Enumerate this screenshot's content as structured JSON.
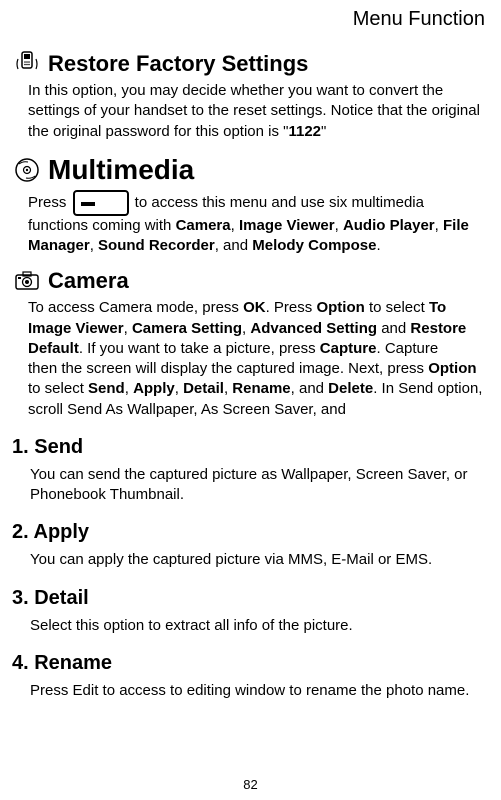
{
  "header": "Menu Function",
  "restore": {
    "title": "Restore Factory Settings",
    "body_pre": "In this option, you may decide whether you want to convert the settings of your handset to the reset settings. Notice that the original the original password for this option is \"",
    "body_bold": "1122",
    "body_post": "\""
  },
  "multimedia": {
    "title": "Multimedia",
    "body_pre": "Press ",
    "body_mid": " to access this menu and use six multimedia functions coming with ",
    "b1": "Camera",
    "c1": ", ",
    "b2": "Image Viewer",
    "c2": ", ",
    "b3": "Audio Player",
    "c3": ", ",
    "b4": "File Manager",
    "c4": ", ",
    "b5": "Sound Recorder",
    "c5": ", and ",
    "b6": "Melody Compose",
    "c6": "."
  },
  "camera": {
    "title": "Camera",
    "p1_pre": "To access Camera mode, press ",
    "p1_b1": "OK",
    "p1_mid1": ". Press ",
    "p1_b2": "Option",
    "p1_mid2": " to select ",
    "p1_b3": "To Image Viewer",
    "p1_c3": ", ",
    "p1_b4": "Camera Setting",
    "p1_c4": ", ",
    "p1_b5": "Advanced Setting",
    "p1_c5": " and ",
    "p1_b6": "Restore Default",
    "p1_mid3": ". If you want to take a picture, press ",
    "p1_b7": "Capture",
    "p1_end": ". Capture",
    "p2_pre": "then the screen will display the captured image. Next, press ",
    "p2_b1": "Option",
    "p2_mid1": " to select ",
    "p2_b2": "Send",
    "p2_c2": ", ",
    "p2_b3": "Apply",
    "p2_c3": ", ",
    "p2_b4": "Detail",
    "p2_c4": ", ",
    "p2_b5": "Rename",
    "p2_c5": ", and ",
    "p2_b6": "Delete",
    "p2_end": ". In Send option, scroll Send As Wallpaper, As Screen Saver, and"
  },
  "items": {
    "send": {
      "heading": "1. Send",
      "body": "You can send the captured picture as Wallpaper, Screen Saver, or Phonebook Thumbnail."
    },
    "apply": {
      "heading": "2. Apply",
      "body": "You can apply the captured picture via MMS, E-Mail or EMS."
    },
    "detail": {
      "heading": "3. Detail",
      "body": "Select this option to extract all info of the picture."
    },
    "rename": {
      "heading": "4. Rename",
      "body": "Press Edit to access to editing window to rename the photo name."
    }
  },
  "page_number": "82"
}
